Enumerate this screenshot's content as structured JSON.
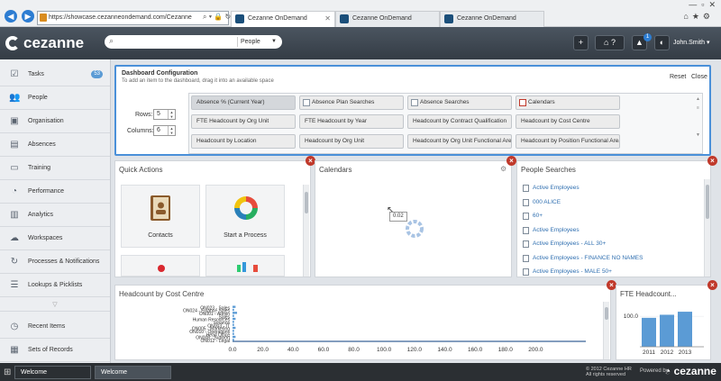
{
  "browser": {
    "url": "https://showcase.cezanneondemand.com/Cezanne",
    "tabs": [
      {
        "label": "Cezanne OnDemand"
      },
      {
        "label": "Cezanne OnDemand"
      },
      {
        "label": "Cezanne OnDemand"
      }
    ]
  },
  "header": {
    "logo": "cezanne",
    "search_type": "People",
    "notification_count": "1",
    "user": "John.Smith"
  },
  "sidebar": {
    "items": [
      {
        "label": "Tasks",
        "badge": "53",
        "icon": "tasks-icon"
      },
      {
        "label": "People",
        "icon": "people-icon"
      },
      {
        "label": "Organisation",
        "icon": "organisation-icon"
      },
      {
        "label": "Absences",
        "icon": "absences-icon"
      },
      {
        "label": "Training",
        "icon": "training-icon"
      },
      {
        "label": "Performance",
        "icon": "performance-icon"
      },
      {
        "label": "Analytics",
        "icon": "analytics-icon"
      },
      {
        "label": "Workspaces",
        "icon": "workspaces-icon"
      },
      {
        "label": "Processes & Notifications",
        "icon": "processes-icon"
      },
      {
        "label": "Lookups & Picklists",
        "icon": "lookups-icon"
      },
      {
        "label": "Recent Items",
        "icon": "recent-items-icon"
      },
      {
        "label": "Sets of Records",
        "icon": "sets-icon"
      }
    ]
  },
  "config": {
    "title": "Dashboard Configuration",
    "subtitle": "To add an item to the dashboard, drag it into an available space",
    "reset": "Reset",
    "close": "Close",
    "rows_label": "Rows:",
    "rows_value": "5",
    "columns_label": "Columns:",
    "columns_value": "6",
    "widgets": [
      "Absence % (Current Year)",
      "Absence Plan Searches",
      "Absence Searches",
      "Calendars",
      "FTE Headcount by Org Unit",
      "FTE Headcount by Year",
      "Headcount by Contract Qualification",
      "Headcount by Cost Centre",
      "Headcount by Location",
      "Headcount by Org Unit",
      "Headcount by Org Unit Functional Area",
      "Headcount by Position Functional Area"
    ]
  },
  "quick_actions": {
    "title": "Quick Actions",
    "tiles": [
      {
        "label": "Contacts"
      },
      {
        "label": "Start a Process"
      }
    ]
  },
  "calendars": {
    "title": "Calendars",
    "tooltip": "0.02"
  },
  "people_searches": {
    "title": "People Searches",
    "items": [
      "Active Employees",
      "000 ALICE",
      "60+",
      "Active Employees",
      "Active Employees - ALL 30+",
      "Active Employees - FINANCE NO NAMES",
      "Active Employees - MALE 50+"
    ]
  },
  "headcount_cost_centre": {
    "title": "Headcount by Cost Centre"
  },
  "fte_headcount": {
    "title": "FTE Headcount..."
  },
  "chart_data": [
    {
      "type": "bar",
      "orientation": "horizontal",
      "title": "Headcount by Cost Centre",
      "categories": [
        "ON023 - Sales",
        "ON024 - Finance Sales",
        "ON001 - Admin",
        "Sales",
        "Human Resources",
        "Finance",
        "ON003 - IT",
        "ON005 - Marketing",
        "ON010 - Operations",
        "Head Office",
        "ON008 - Support",
        "ON012 - Legal"
      ],
      "values": [
        2,
        1,
        3,
        1,
        2,
        1,
        1,
        2,
        1,
        1,
        2,
        1
      ],
      "xticks": [
        "0.0",
        "20.0",
        "40.0",
        "60.0",
        "80.0",
        "100.0",
        "120.0",
        "140.0",
        "160.0",
        "180.0",
        "200.0"
      ],
      "xlim": [
        0,
        220
      ]
    },
    {
      "type": "bar",
      "title": "FTE Headcount...",
      "categories": [
        "2011",
        "2012",
        "2013"
      ],
      "values": [
        95,
        105,
        115
      ],
      "yticks": [
        "100.0"
      ],
      "ylim": [
        0,
        130
      ],
      "color": "#5b9bd5"
    }
  ]
}
